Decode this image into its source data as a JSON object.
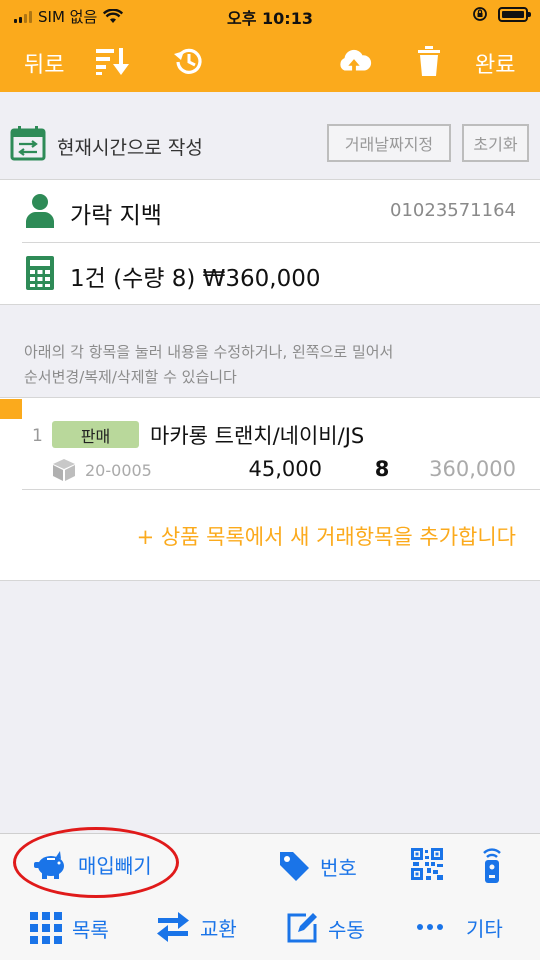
{
  "status_bar": {
    "carrier": "SIM 없음",
    "time": "오후 10:13"
  },
  "nav": {
    "back_label": "뒤로",
    "done_label": "완료"
  },
  "date_row": {
    "label": "현재시간으로 작성",
    "set_date_button": "거래날짜지정",
    "reset_button": "초기화"
  },
  "customer": {
    "name": "가락 지백",
    "phone": "01023571164"
  },
  "summary": {
    "text": "1건 (수량 8) ₩360,000"
  },
  "help_text": {
    "line1": "아래의 각 항목을 눌러 내용을 수정하거나, 왼쪽으로 밀어서",
    "line2": "순서변경/복제/삭제할 수 있습니다"
  },
  "items": [
    {
      "number": "1",
      "type": "판매",
      "name": "마카롱 트랜치/네이비/JS",
      "code": "20-0005",
      "price": "45,000",
      "quantity": "8",
      "total": "360,000"
    }
  ],
  "add_item_link": "+ 상품 목록에서 새 거래항목을 추가합니다",
  "toolbar": {
    "purchase_deduct": "매입빼기",
    "number": "번호",
    "list": "목록",
    "exchange": "교환",
    "manual": "수동",
    "etc": "기타"
  },
  "colors": {
    "accent": "#fbaa1c",
    "toolbar_blue": "#1a74e8",
    "badge_green": "#b9d89b",
    "annotation_red": "#e01a1a",
    "icon_green": "#2e8b57"
  }
}
